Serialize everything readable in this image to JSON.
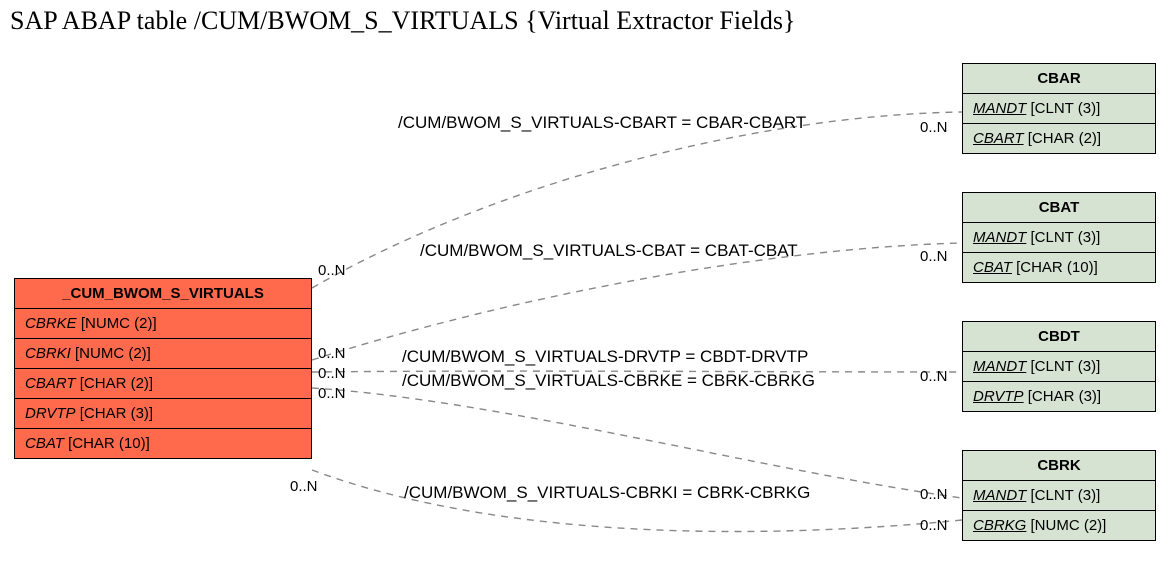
{
  "title": "SAP ABAP table /CUM/BWOM_S_VIRTUALS {Virtual Extractor Fields}",
  "mainEntity": {
    "name": "_CUM_BWOM_S_VIRTUALS",
    "fields": [
      {
        "name": "CBRKE",
        "type": "[NUMC (2)]"
      },
      {
        "name": "CBRKI",
        "type": "[NUMC (2)]"
      },
      {
        "name": "CBART",
        "type": "[CHAR (2)]"
      },
      {
        "name": "DRVTP",
        "type": "[CHAR (3)]"
      },
      {
        "name": "CBAT",
        "type": "[CHAR (10)]"
      }
    ]
  },
  "entities": [
    {
      "name": "CBAR",
      "fields": [
        {
          "name": "MANDT",
          "type": "[CLNT (3)]",
          "ul": true
        },
        {
          "name": "CBART",
          "type": "[CHAR (2)]",
          "ul": true
        }
      ]
    },
    {
      "name": "CBAT",
      "fields": [
        {
          "name": "MANDT",
          "type": "[CLNT (3)]",
          "ul": true
        },
        {
          "name": "CBAT",
          "type": "[CHAR (10)]",
          "ul": true
        }
      ]
    },
    {
      "name": "CBDT",
      "fields": [
        {
          "name": "MANDT",
          "type": "[CLNT (3)]",
          "ul": true,
          "it": true
        },
        {
          "name": "DRVTP",
          "type": "[CHAR (3)]",
          "ul": true
        }
      ]
    },
    {
      "name": "CBRK",
      "fields": [
        {
          "name": "MANDT",
          "type": "[CLNT (3)]",
          "ul": true
        },
        {
          "name": "CBRKG",
          "type": "[NUMC (2)]",
          "ul": true
        }
      ]
    }
  ],
  "relations": [
    {
      "label": "/CUM/BWOM_S_VIRTUALS-CBART = CBAR-CBART"
    },
    {
      "label": "/CUM/BWOM_S_VIRTUALS-CBAT = CBAT-CBAT"
    },
    {
      "label": "/CUM/BWOM_S_VIRTUALS-DRVTP = CBDT-DRVTP"
    },
    {
      "label": "/CUM/BWOM_S_VIRTUALS-CBRKE = CBRK-CBRKG"
    },
    {
      "label": "/CUM/BWOM_S_VIRTUALS-CBRKI = CBRK-CBRKG"
    }
  ],
  "cards": {
    "leftTop": "0..N",
    "leftMid1": "0..N",
    "leftMid2": "0..N",
    "leftMid3": "0..N",
    "leftBot": "0..N",
    "rightCBAR": "0..N",
    "rightCBAT": "0..N",
    "rightCBDT": "0..N",
    "rightCBRK1": "0..N",
    "rightCBRK2": "0..N"
  }
}
